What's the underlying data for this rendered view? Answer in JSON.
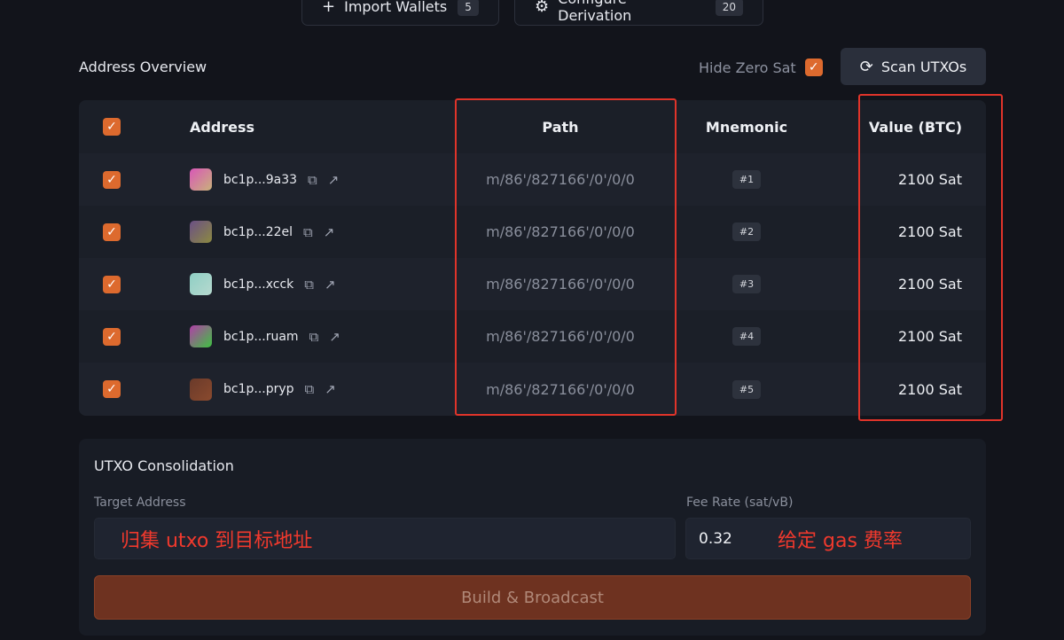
{
  "toolbar": {
    "import_label": "Import Wallets",
    "import_count": "5",
    "config_label": "Configure Derivation",
    "config_count": "20"
  },
  "overview": {
    "title": "Address Overview",
    "hide_zero_label": "Hide Zero Sat",
    "hide_zero_checked": true,
    "scan_label": "Scan UTXOs"
  },
  "table": {
    "headers": {
      "address": "Address",
      "path": "Path",
      "mnemonic": "Mnemonic",
      "value": "Value (BTC)"
    },
    "rows": [
      {
        "address": "bc1p...9a33",
        "path": "m/86'/827166'/0'/0/0",
        "mnemonic": "#1",
        "value": "2100 Sat",
        "color_a": "#d957b8",
        "color_b": "#c9b27a"
      },
      {
        "address": "bc1p...22el",
        "path": "m/86'/827166'/0'/0/0",
        "mnemonic": "#2",
        "value": "2100 Sat",
        "color_a": "#6a4f86",
        "color_b": "#8c8a40"
      },
      {
        "address": "bc1p...xcck",
        "path": "m/86'/827166'/0'/0/0",
        "mnemonic": "#3",
        "value": "2100 Sat",
        "color_a": "#8fcfc4",
        "color_b": "#b6d9cf"
      },
      {
        "address": "bc1p...ruam",
        "path": "m/86'/827166'/0'/0/0",
        "mnemonic": "#4",
        "value": "2100 Sat",
        "color_a": "#b13fa8",
        "color_b": "#3ec241"
      },
      {
        "address": "bc1p...pryp",
        "path": "m/86'/827166'/0'/0/0",
        "mnemonic": "#5",
        "value": "2100 Sat",
        "color_a": "#6a3a2a",
        "color_b": "#8a4a2e"
      }
    ]
  },
  "consolidation": {
    "title": "UTXO Consolidation",
    "target_label": "Target Address",
    "target_annotation": "归集 utxo 到目标地址",
    "fee_label": "Fee Rate (sat/vB)",
    "fee_value": "0.32",
    "fee_annotation": "给定 gas 费率",
    "build_label": "Build & Broadcast"
  },
  "colors": {
    "accent": "#dd6a2e",
    "highlight": "#e0342a",
    "background": "#12141b"
  }
}
